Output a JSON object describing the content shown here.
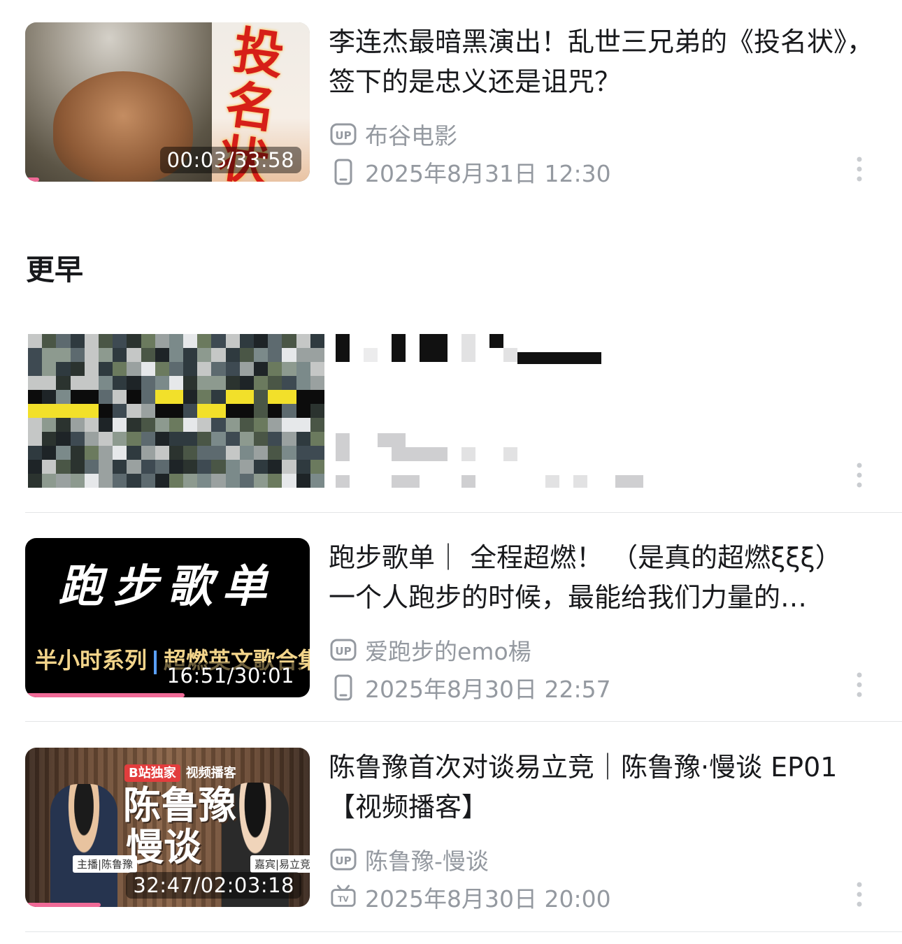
{
  "items": [
    {
      "title": "李连杰最暗黑演出！乱世三兄弟的《投名状》，签下的是忠义还是诅咒？",
      "uploader": "布谷电影",
      "datetime": "2025年8月31日 12:30",
      "duration": "00:03/33:58",
      "progress": 0.01,
      "device_icon": "phone-icon",
      "thumb_text": "投名状"
    },
    {
      "title": "",
      "uploader": "",
      "datetime": "",
      "duration": "",
      "redacted": true
    },
    {
      "title": "跑步歌单｜ 全程超燃！ （是真的超燃ξξξ） 一个人跑步的时候，最能给我们力量的…",
      "uploader": "爱跑步的emo楊",
      "datetime": "2025年8月30日 22:57",
      "duration": "16:51/30:01",
      "progress": 0.56,
      "device_icon": "phone-icon",
      "thumb_main": "跑步歌单",
      "thumb_left": "半小时系列",
      "thumb_right": "超燃英文歌合集"
    },
    {
      "title": "陈鲁豫首次对谈易立竞｜陈鲁豫·慢谈 EP01 【视频播客】",
      "uploader": "陈鲁豫-慢谈",
      "datetime": "2025年8月30日 20:00",
      "duration": "32:47/02:03:18",
      "progress": 0.27,
      "device_icon": "tv-icon",
      "thumb_badge_b": "B站独家",
      "thumb_badge": "视频播客",
      "thumb_name1": "陈鲁豫",
      "thumb_name2": "慢谈",
      "thumb_host": "主播|陈鲁豫",
      "thumb_guest": "嘉宾|易立竞"
    }
  ],
  "section_label": "更早",
  "up_badge": "UP",
  "colors": {
    "accent": "#f06a97",
    "meta": "#9499a0",
    "text": "#18191c",
    "divider": "#e3e5e7"
  }
}
